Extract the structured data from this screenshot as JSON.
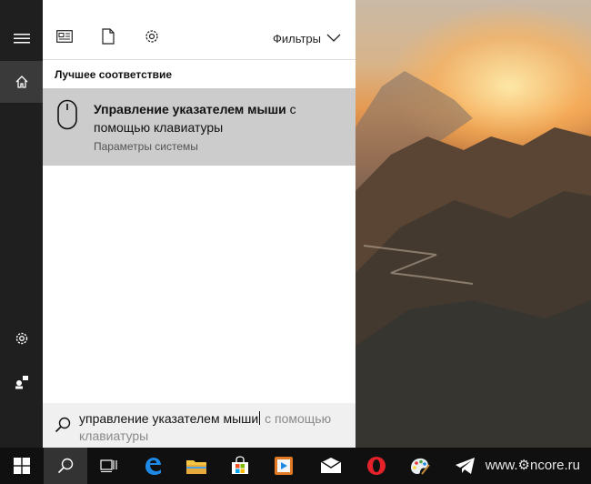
{
  "rail": {
    "items": [
      {
        "name": "hamburger-menu-icon"
      },
      {
        "name": "home-icon",
        "active": true
      },
      {
        "name": "gear-icon"
      },
      {
        "name": "feedback-icon"
      }
    ]
  },
  "panel": {
    "toolbar": {
      "icons": [
        "news-icon",
        "document-icon",
        "settings-icon"
      ],
      "filters_label": "Фильтры"
    },
    "section_title": "Лучшее соответствие",
    "best_match": {
      "title_bold": "Управление указателем мыши",
      "title_rest": " с помощью клавиатуры",
      "subtitle": "Параметры системы",
      "icon": "mouse-icon"
    },
    "search": {
      "typed": "управление указателем мыши",
      "suggestion": " с помощью клавиатуры"
    }
  },
  "taskbar": {
    "items": [
      "windows-start-icon",
      "search-icon",
      "task-view-icon",
      "edge-icon",
      "file-explorer-icon",
      "store-icon",
      "media-player-icon",
      "mail-icon",
      "opera-icon",
      "paint-icon",
      "telegram-icon"
    ],
    "watermark": "www.⚙ncore.ru"
  },
  "colors": {
    "rail": "#1f1f1f",
    "selected_result": "#cccccc",
    "taskbar": "#101010"
  }
}
